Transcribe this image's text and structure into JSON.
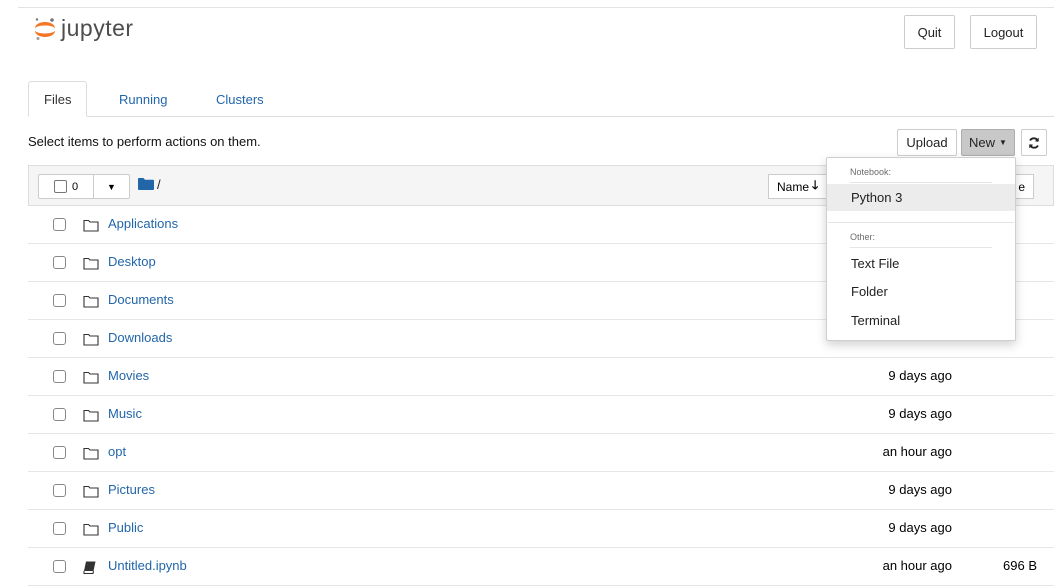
{
  "app": {
    "name": "jupyter",
    "accent_color": "#f37726",
    "link_color": "#2266aa"
  },
  "header": {
    "quit_label": "Quit",
    "logout_label": "Logout"
  },
  "tabs": [
    {
      "label": "Files",
      "active": true
    },
    {
      "label": "Running",
      "active": false
    },
    {
      "label": "Clusters",
      "active": false
    }
  ],
  "toolbar": {
    "hint": "Select items to perform actions on them.",
    "upload_label": "Upload",
    "new_label": "New",
    "new_caret_icon": "caret-down-icon",
    "refresh_icon": "refresh-icon"
  },
  "list_header": {
    "selected_count": "0",
    "path_icon": "folder-icon",
    "path": "/",
    "sort_name_label": "Name",
    "sort_icon": "arrow-down-icon",
    "size_label_visible": "e"
  },
  "new_menu": {
    "sections": [
      {
        "heading": "Notebook:",
        "items": [
          "Python 3"
        ]
      },
      {
        "heading": "Other:",
        "items": [
          "Text File",
          "Folder",
          "Terminal"
        ]
      }
    ],
    "highlighted_item": "Python 3"
  },
  "files": [
    {
      "name": "Applications",
      "type": "folder",
      "modified": "",
      "size": ""
    },
    {
      "name": "Desktop",
      "type": "folder",
      "modified": "",
      "size": ""
    },
    {
      "name": "Documents",
      "type": "folder",
      "modified": "",
      "size": ""
    },
    {
      "name": "Downloads",
      "type": "folder",
      "modified": "",
      "size": ""
    },
    {
      "name": "Movies",
      "type": "folder",
      "modified": "9 days ago",
      "size": ""
    },
    {
      "name": "Music",
      "type": "folder",
      "modified": "9 days ago",
      "size": ""
    },
    {
      "name": "opt",
      "type": "folder",
      "modified": "an hour ago",
      "size": ""
    },
    {
      "name": "Pictures",
      "type": "folder",
      "modified": "9 days ago",
      "size": ""
    },
    {
      "name": "Public",
      "type": "folder",
      "modified": "9 days ago",
      "size": ""
    },
    {
      "name": "Untitled.ipynb",
      "type": "notebook",
      "modified": "an hour ago",
      "size": "696 B"
    }
  ]
}
